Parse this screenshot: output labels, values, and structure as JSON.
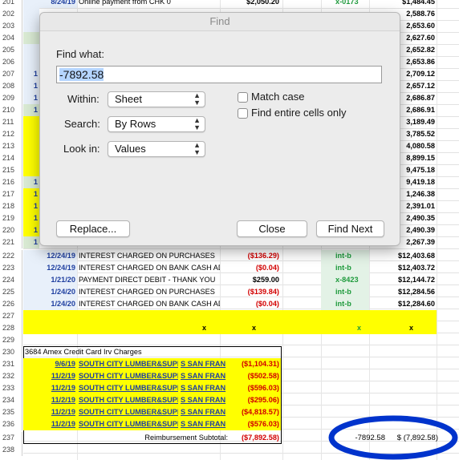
{
  "find_dialog": {
    "title": "Find",
    "find_what_label": "Find what:",
    "find_what_value": "-7892.58",
    "within_label": "Within:",
    "within_value": "Sheet",
    "search_label": "Search:",
    "search_value": "By Rows",
    "lookin_label": "Look in:",
    "lookin_value": "Values",
    "match_case_label": "Match case",
    "entire_cells_label": "Find entire cells only",
    "replace_button": "Replace...",
    "close_button": "Close",
    "find_next_button": "Find Next"
  },
  "sheet": {
    "partial_top": {
      "row": "201",
      "date": "8/24/19",
      "desc": "Online payment from CHK 0",
      "amount": "$2,050.20",
      "ref": "x-0173",
      "balance": "$1,484.45"
    },
    "hidden_rows": [
      {
        "row": "202",
        "col_a": "",
        "balance": "2,588.76"
      },
      {
        "row": "203",
        "col_a": "",
        "balance": "2,653.60"
      },
      {
        "row": "204",
        "col_a": "",
        "balance": "2,627.60"
      },
      {
        "row": "205",
        "col_a": "",
        "balance": "2,652.82"
      },
      {
        "row": "206",
        "col_a": "",
        "balance": "2,653.86"
      },
      {
        "row": "207",
        "col_a": "1",
        "balance": "2,709.12"
      },
      {
        "row": "208",
        "col_a": "1",
        "balance": "2,657.12"
      },
      {
        "row": "209",
        "col_a": "1",
        "balance": "2,686.87"
      },
      {
        "row": "210",
        "col_a": "1",
        "balance": "2,686.91"
      },
      {
        "row": "211",
        "col_a": "",
        "balance": "3,189.49"
      },
      {
        "row": "212",
        "col_a": "",
        "balance": "3,785.52"
      },
      {
        "row": "213",
        "col_a": "",
        "balance": "4,080.58"
      },
      {
        "row": "214",
        "col_a": "",
        "balance": "8,899.15"
      },
      {
        "row": "215",
        "col_a": "",
        "balance": "9,475.18"
      },
      {
        "row": "216",
        "col_a": "1",
        "balance": "9,419.18"
      },
      {
        "row": "217",
        "col_a": "1",
        "balance": "1,246.38"
      },
      {
        "row": "218",
        "col_a": "1",
        "balance": "2,391.01"
      },
      {
        "row": "219",
        "col_a": "1",
        "balance": "2,490.35"
      },
      {
        "row": "220",
        "col_a": "1",
        "balance": "2,490.39"
      },
      {
        "row": "221",
        "col_a": "1",
        "balance": "2,267.39"
      }
    ],
    "rows": [
      {
        "row": "222",
        "date": "12/24/19",
        "desc": "INTEREST CHARGED ON PURCHASES",
        "amount": "($136.29)",
        "amt_color": "red",
        "ref": "int-b",
        "balance": "$12,403.68"
      },
      {
        "row": "223",
        "date": "12/24/19",
        "desc": "INTEREST CHARGED ON BANK CASH ADVAN",
        "amount": "($0.04)",
        "amt_color": "red",
        "ref": "int-b",
        "balance": "$12,403.72"
      },
      {
        "row": "224",
        "date": "1/21/20",
        "desc": "PAYMENT DIRECT DEBIT - THANK YOU",
        "amount": "$259.00",
        "amt_color": "black",
        "ref": "x-8423",
        "balance": "$12,144.72"
      },
      {
        "row": "225",
        "date": "1/24/20",
        "desc": "INTEREST CHARGED ON PURCHASES",
        "amount": "($139.84)",
        "amt_color": "red",
        "ref": "int-b",
        "balance": "$12,284.56"
      },
      {
        "row": "226",
        "date": "1/24/20",
        "desc": "INTEREST CHARGED ON BANK CASH ADVAN",
        "amount": "($0.04)",
        "amt_color": "red",
        "ref": "int-b",
        "balance": "$12,284.60"
      }
    ],
    "row_227": "227",
    "row_228": {
      "row": "228",
      "mark_c": "x",
      "mark_d": "x",
      "mark_f": "x",
      "mark_g": "x"
    },
    "row_229": "229",
    "amex_header": {
      "row": "230",
      "text": "3684 Amex Credit Card Irv Charges"
    },
    "amex_rows": [
      {
        "row": "231",
        "date": "9/6/19",
        "desc": "SOUTH CITY LUMBER&SUPL",
        "loc": "S SAN FRAN",
        "amount": "($1,104.31)"
      },
      {
        "row": "232",
        "date": "11/2/19",
        "desc": "SOUTH CITY LUMBER&SUPL",
        "loc": "S SAN FRAN",
        "amount": "($502.58)"
      },
      {
        "row": "233",
        "date": "11/2/19",
        "desc": "SOUTH CITY LUMBER&SUPL",
        "loc": "S SAN FRAN",
        "amount": "($596.03)"
      },
      {
        "row": "234",
        "date": "11/2/19",
        "desc": "SOUTH CITY LUMBER&SUPL",
        "loc": "S SAN FRAN",
        "amount": "($295.06)"
      },
      {
        "row": "235",
        "date": "11/2/19",
        "desc": "SOUTH CITY LUMBER&SUPL",
        "loc": "S SAN FRAN",
        "amount": "($4,818.57)"
      },
      {
        "row": "236",
        "date": "11/2/19",
        "desc": "SOUTH CITY LUMBER&SUPL",
        "loc": "S SAN FRAN",
        "amount": "($576.03)"
      }
    ],
    "subtotal": {
      "row": "237",
      "label": "Reimbursement Subtotal:",
      "amount": "($7,892.58)",
      "found_value": "-7892.58",
      "found_currency": "$ (7,892.58)"
    },
    "row_238": "238",
    "colors": {
      "yellow": "#ffff00",
      "green_fill": "#d9ead3",
      "red": "#d20000",
      "blue_text": "#1f3fa0",
      "green_text": "#1e9a3c",
      "ellipse": "#0033cc"
    }
  }
}
